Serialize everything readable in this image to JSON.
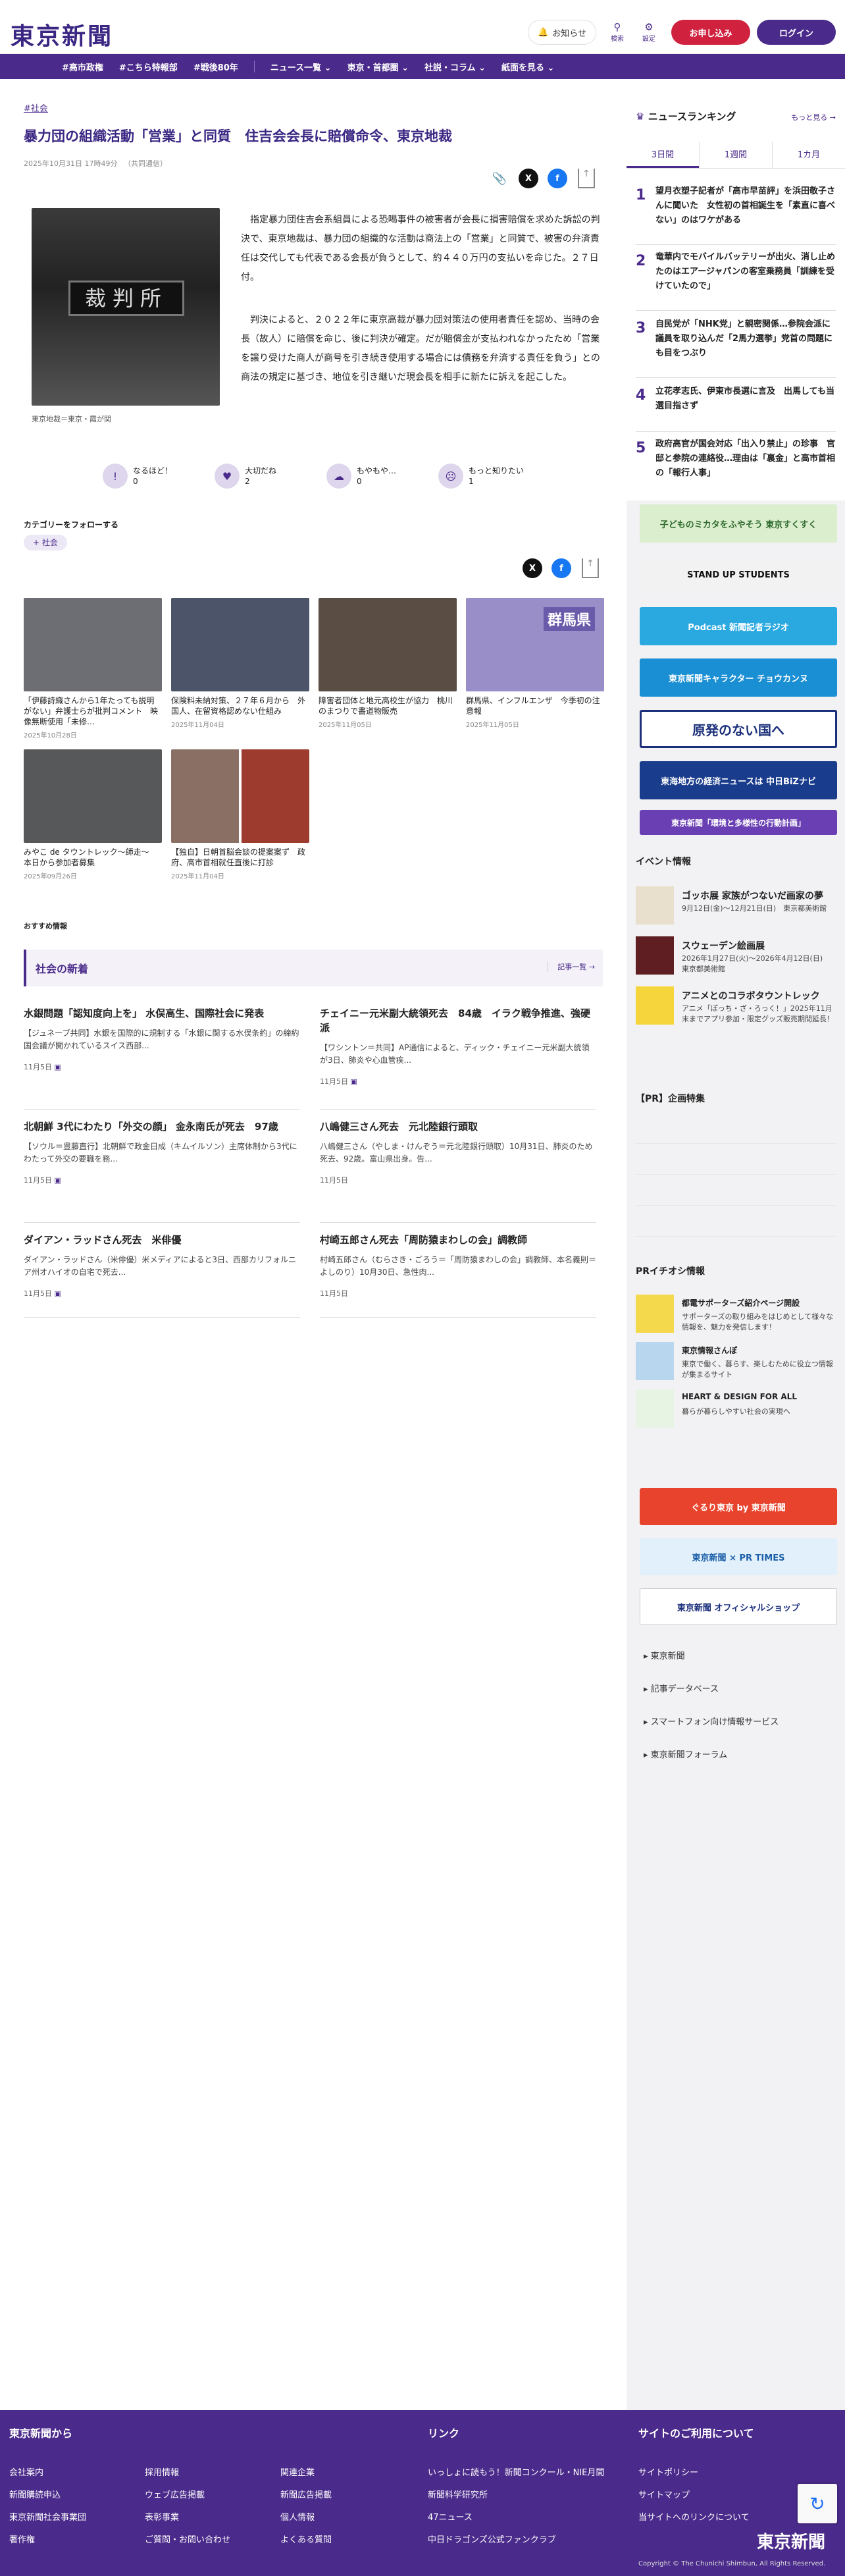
{
  "header": {
    "logo": "東京新聞",
    "notice_label": "お知らせ",
    "search_label": "検索",
    "settings_label": "設定",
    "subscribe_label": "お申し込み",
    "login_label": "ログイン"
  },
  "nav": {
    "items": [
      "#高市政権",
      "#こちら特報部",
      "#戦後80年",
      "ニュース一覧 ⌄",
      "東京・首都圏 ⌄",
      "社説・コラム ⌄",
      "紙面を見る ⌄"
    ]
  },
  "article": {
    "tag": "#社会",
    "title": "暴力団の組織活動「営業」と同質　住吉会会長に賠償命令、東京地裁",
    "date": "2025年10月31日 17時49分",
    "source": "（共同通信）",
    "photo_title": "裁判所",
    "caption": "東京地裁＝東京・霞が関",
    "p1": "指定暴力団住吉会系組員による恐喝事件の被害者が会長に損害賠償を求めた訴訟の判決で、東京地裁は、暴力団の組織的な活動は商法上の「営業」と同質で、被害の弁済責任は交代しても代表である会長が負うとして、約４４０万円の支払いを命じた。２７日付。",
    "p2": "判決によると、２０２２年に東京高裁が暴力団対策法の使用者責任を認め、当時の会長（故人）に賠償を命じ、後に判決が確定。だが賠償金が支払われなかったため「営業を譲り受けた商人が商号を引き続き使用する場合には債務を弁済する責任を負う」との商法の規定に基づき、地位を引き継いだ現会長を相手に新たに訴えを起こした。"
  },
  "reactions": [
    {
      "label": "なるほど！",
      "count": "0"
    },
    {
      "label": "大切だね",
      "count": "2"
    },
    {
      "label": "もやもや…",
      "count": "0"
    },
    {
      "label": "もっと知りたい",
      "count": "1"
    }
  ],
  "follow": {
    "heading": "カテゴリーをフォローする",
    "chip": "社会"
  },
  "related": [
    {
      "caption": "「伊藤詩織さんから1年たっても説明がない」弁護士らが批判コメント　映像無断使用「未修…",
      "date": "2025年10月28日",
      "color": "#6d6d74"
    },
    {
      "caption": "保険料未納対策、２７年６月から　外国人、在留資格認めない仕組み",
      "date": "2025年11月04日",
      "color": "#4b5468"
    },
    {
      "caption": "障害者団体と地元高校生が協力　桃川のまつりで書道物販売",
      "date": "2025年11月05日",
      "color": "#5a4d44"
    },
    {
      "caption": "群馬県、インフルエンザ　今季初の注意報",
      "date": "2025年11月05日",
      "color": "#9a8ec9",
      "overlay": "群馬県"
    },
    {
      "caption": "みやこ de タウントレック〜師走〜　本日から参加者募集",
      "date": "2025年09月26日",
      "color": "#56585a"
    },
    {
      "caption": "【独自】日朝首脳会談の提案案ず　政府、高市首相就任直後に打診",
      "date": "2025年11月04日",
      "color": "#7a5a52"
    }
  ],
  "recommend": {
    "label": "おすすめ情報"
  },
  "latest": {
    "heading": "社会の新着",
    "more": "記事一覧 →",
    "items": [
      {
        "title": "水銀問題「認知度向上を」 水俣高生、国際社会に発表",
        "body": "【ジュネーブ共同】水銀を国際的に規制する「水銀に関する水俣条約」の締約国会議が開かれているスイス西部...",
        "date": "11月5日"
      },
      {
        "title": "チェイニー元米副大統領死去　84歳　イラク戦争推進、強硬派",
        "body": "【ワシントン＝共同】AP通信によると、ディック・チェイニー元米副大統領が3日、肺炎や心血管疾...",
        "date": "11月5日"
      },
      {
        "title": "北朝鮮 3代にわたり「外交の顔」 金永南氏が死去　97歳",
        "body": "【ソウル＝豊藤直行】北朝鮮で政金日成（キムイルソン）主席体制から3代にわたって外交の要職を務...",
        "date": "11月5日"
      },
      {
        "title": "八嶋健三さん死去　元北陸銀行頭取",
        "body": "八嶋健三さん（やしま・けんぞう＝元北陸銀行頭取）10月31日、肺炎のため死去、92歳。富山県出身。告...",
        "date": "11月5日"
      },
      {
        "title": "ダイアン・ラッドさん死去　米俳優",
        "body": "ダイアン・ラッドさん（米俳優）米メディアによると3日、西部カリフォルニア州オハイオの自宅で死去...",
        "date": "11月5日"
      },
      {
        "title": "村崎五郎さん死去「周防猿まわしの会」調教師",
        "body": "村崎五郎さん（むらさき・ごろう＝「周防猿まわしの会」調教師、本名義則＝よしのり）10月30日、急性肉...",
        "date": "11月5日"
      }
    ]
  },
  "ranking": {
    "heading": "ニュースランキング",
    "more": "もっと見る →",
    "tabs": [
      "3日間",
      "1週間",
      "1カ月"
    ],
    "items": [
      {
        "n": "1",
        "title": "望月衣塑子記者が「高市早苗評」を浜田敬子さんに聞いた　女性初の首相誕生を「素直に喜べない」のはワケがある"
      },
      {
        "n": "2",
        "title": "竜華内でモバイルバッテリーが出火、消し止めたのはエアージャパンの客室乗務員「訓練を受けていたので」"
      },
      {
        "n": "3",
        "title": "自民党が「NHK党」と親密関係…参院会派に議員を取り込んだ「2馬力選挙」党首の問題にも目をつぶり"
      },
      {
        "n": "4",
        "title": "立花孝志氏、伊東市長選に言及　出馬しても当選目指さず"
      },
      {
        "n": "5",
        "title": "政府高官が国会対応「出入り禁止」の珍事　官邸と参院の連絡役…理由は「裏金」と高市首相の「報行人事」"
      }
    ]
  },
  "side_banners": [
    {
      "text": "子どものミカタをふやそう 東京すくすく",
      "bg": "#dbeecd",
      "fg": "#2f6b2f"
    },
    {
      "text": "STAND UP STUDENTS",
      "bg": "#f2f2f2",
      "fg": "#111"
    },
    {
      "text": "Podcast 新聞記者ラジオ",
      "bg": "#2aa9e0",
      "fg": "#fff"
    },
    {
      "text": "東京新聞キャラクター チョウカンヌ",
      "bg": "#1b8fd3",
      "fg": "#fff"
    },
    {
      "text": "原発のない国へ",
      "bg": "#ffffff",
      "fg": "#1b2f7a"
    },
    {
      "text": "東海地方の経済ニュースは 中日BiZナビ",
      "bg": "#1a3c8c",
      "fg": "#fff"
    },
    {
      "text": "東京新聞「環境と多様性の行動計画」",
      "bg": "#6a3fb4",
      "fg": "#fff"
    }
  ],
  "events": {
    "heading": "イベント情報",
    "items": [
      {
        "title": "ゴッホ展 家族がつないだ画家の夢",
        "desc": "9月12日(金)〜12月21日(日)　東京都美術館",
        "color": "#e8e0cc"
      },
      {
        "title": "スウェーデン絵画展",
        "desc": "2026年1月27日(火)〜2026年4月12日(日)　東京都美術館",
        "color": "#5e1e22"
      },
      {
        "title": "アニメとのコラボタウントレック",
        "desc": "アニメ「ぽっち・ざ・ろっく！」2025年11月末までアプリ参加・限定グッズ販売期間延長！",
        "color": "#f5d53b"
      }
    ]
  },
  "pr": {
    "heading": "【PR】企画特集"
  },
  "pr_info": {
    "heading": "PRイチオシ情報",
    "items": [
      {
        "title": "都電サポーターズ紹介ページ開設",
        "desc": "サポーターズの取り組みをはじめとして様々な情報を、魅力を発信します！",
        "color": "#f4d94c"
      },
      {
        "title": "東京情報さんぽ",
        "desc": "東京で働く、暮らす、楽しむために役立つ情報が集まるサイト",
        "color": "#b8d7ee"
      },
      {
        "title": "HEART & DESIGN FOR ALL",
        "desc": "暮らが暮らしやすい社会の実現へ",
        "color": "#e7f4e4"
      }
    ]
  },
  "bottom_banners": [
    {
      "text": "ぐるり東京 by 東京新聞",
      "bg": "#e8432c",
      "fg": "#fff"
    },
    {
      "text": "東京新聞 × PR TIMES",
      "bg": "#e2f0fb",
      "fg": "#1a5ea8"
    },
    {
      "text": "東京新聞 オフィシャルショップ",
      "bg": "#ffffff",
      "fg": "#1a2f7a"
    }
  ],
  "side_links": [
    "東京新聞",
    "記事データベース",
    "スマートフォン向け情報サービス",
    "東京新聞フォーラム"
  ],
  "footer": {
    "col1_heading": "東京新聞から",
    "col2_heading": "リンク",
    "col3_heading": "サイトのご利用について",
    "links1": [
      "会社案内",
      "採用情報",
      "関連企業",
      "新聞購読申込",
      "ウェブ広告掲載",
      "新聞広告掲載",
      "東京新聞社会事業団",
      "表彰事業",
      "個人情報",
      "著作権",
      "ご質問・お問い合わせ",
      "よくある質問"
    ],
    "links2": [
      "いっしょに読もう！新聞コンクール・NIE月間",
      "新聞科学研究所",
      "47ニュース",
      "中日ドラゴンズ公式ファンクラブ"
    ],
    "links3": [
      "サイトポリシー",
      "サイトマップ",
      "当サイトへのリンクについて"
    ],
    "logo": "東京新聞",
    "copyright": "Copyright © The Chunichi Shimbun, All Rights Reserved."
  }
}
